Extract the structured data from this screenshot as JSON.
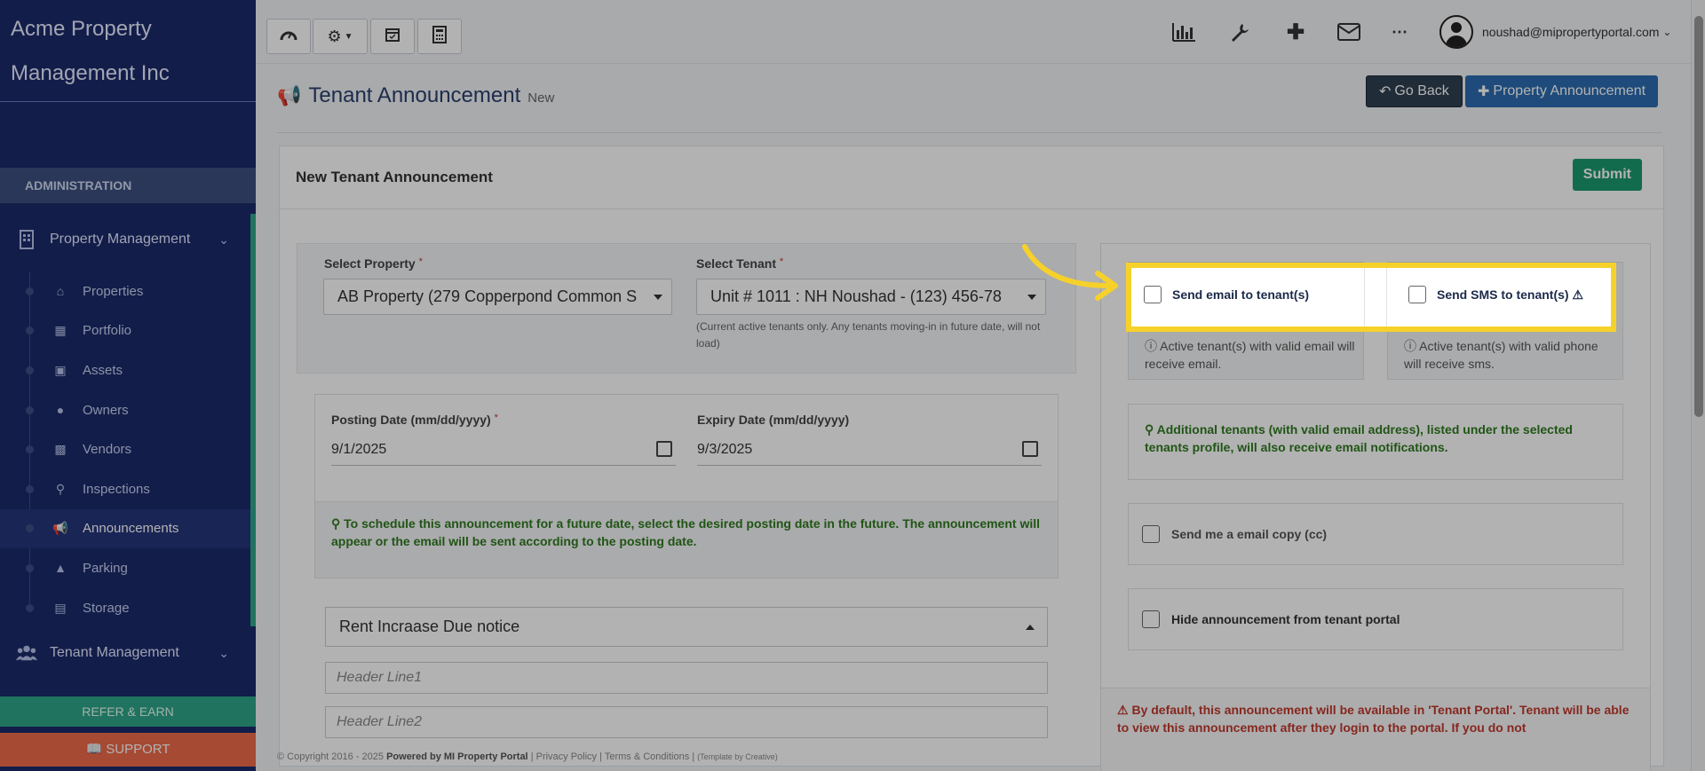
{
  "sidebar": {
    "company": "Acme Property Management Inc",
    "section_label": "ADMINISTRATION",
    "group_property": "Property Management",
    "items": [
      {
        "label": "Properties",
        "icon": "home-icon"
      },
      {
        "label": "Portfolio",
        "icon": "building-icon"
      },
      {
        "label": "Assets",
        "icon": "archive-icon"
      },
      {
        "label": "Owners",
        "icon": "user-icon"
      },
      {
        "label": "Vendors",
        "icon": "briefcase-icon"
      },
      {
        "label": "Inspections",
        "icon": "search-plus-icon"
      },
      {
        "label": "Announcements",
        "icon": "bullhorn-icon"
      },
      {
        "label": "Parking",
        "icon": "car-icon"
      },
      {
        "label": "Storage",
        "icon": "storage-icon"
      }
    ],
    "group_tenant": "Tenant Management",
    "refer_label": "REFER & EARN",
    "support_label": "SUPPORT"
  },
  "topbar": {
    "user_email": "noushad@mipropertyportal.com"
  },
  "page": {
    "title": "Tenant Announcement",
    "subtitle": "New",
    "go_back_label": "Go Back",
    "property_announcement_label": "Property Announcement"
  },
  "form": {
    "panel_title": "New Tenant Announcement",
    "submit_label": "Submit",
    "select_property_label": "Select Property",
    "select_property_value": "AB Property (279 Copperpond Common S",
    "select_tenant_label": "Select Tenant",
    "select_tenant_value": "Unit # 1011 : NH Noushad - (123) 456-78",
    "tenant_note": "(Current active tenants only. Any tenants moving-in in future date, will not load)",
    "posting_date_label": "Posting Date (mm/dd/yyyy)",
    "posting_date_value": "9/1/2025",
    "expiry_date_label": "Expiry Date (mm/dd/yyyy)",
    "expiry_date_value": "9/3/2025",
    "schedule_tip": "To schedule this announcement for a future date, select the desired posting date in the future. The announcement will appear or the email will be sent according to the posting date.",
    "subject_value": "Rent Incraase Due notice",
    "header_line1_placeholder": "Header Line1",
    "header_line2_placeholder": "Header Line2"
  },
  "options": {
    "send_email_label": "Send email to tenant(s)",
    "send_sms_label": "Send SMS to tenant(s)",
    "email_note": "Active tenant(s) with valid email will receive email.",
    "sms_note": "Active tenant(s) with valid phone will receive sms.",
    "additional_note": "Additional tenants (with valid email address), listed under the selected tenants profile, will also receive email notifications.",
    "send_copy_label": "Send me a email copy (cc)",
    "hide_label": "Hide announcement from tenant portal",
    "default_warning": "By default, this announcement will be available in 'Tenant Portal'. Tenant will be able to view this announcement after they login to the portal. If you do not"
  },
  "footer": {
    "copyright": "© Copyright 2016 - 2025",
    "powered": "Powered by MI Property Portal",
    "links": "| Privacy Policy | Terms & Conditions |",
    "template": "(Template by Creative)"
  },
  "colors": {
    "sidebar_bg": "#1b2a6b",
    "accent_green": "#2ea587",
    "highlight_yellow": "#f6d12a",
    "primary_blue": "#2b6cb0"
  }
}
